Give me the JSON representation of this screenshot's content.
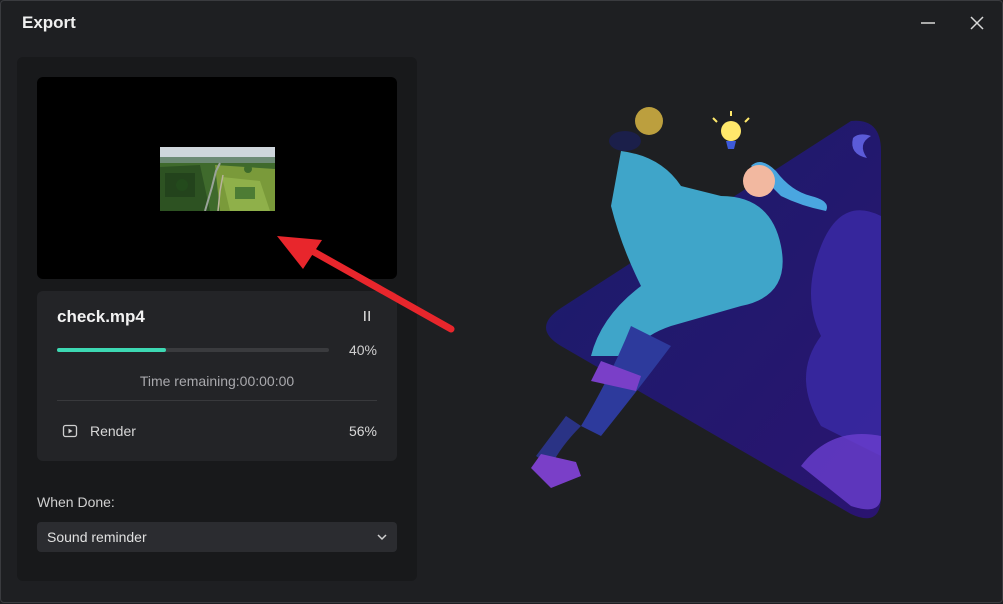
{
  "window": {
    "title": "Export",
    "minimize_icon": "minimize-icon",
    "close_icon": "close-icon"
  },
  "preview": {
    "thumbnail": "aerial-landscape-thumbnail"
  },
  "progress": {
    "filename": "check.mp4",
    "pause_icon": "pause-icon",
    "percent": 40,
    "percent_label": "40%",
    "time_remaining": "Time remaining:00:00:00",
    "stage_icon": "play-square-icon",
    "stage_label": "Render",
    "stage_percent": "56%"
  },
  "when_done": {
    "label": "When Done:",
    "selected": "Sound reminder",
    "chevron_icon": "chevron-down-icon"
  },
  "colors": {
    "accent": "#3dd9b3",
    "annotation_arrow": "#e8262c",
    "background": "#1e1f22",
    "panel": "#18191b"
  }
}
